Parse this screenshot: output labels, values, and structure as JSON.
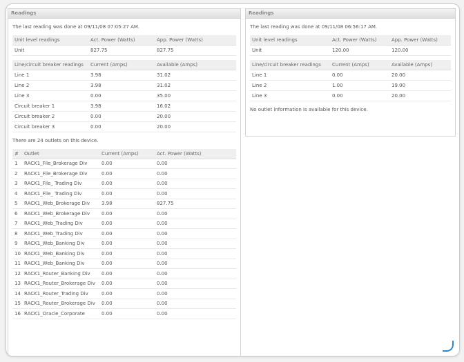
{
  "left": {
    "title": "Readings",
    "last_reading": "The last reading was done at 09/11/08 07:05:27 AM.",
    "unit_headers": [
      "Unit level readings",
      "Act. Power (Watts)",
      "App. Power (Watts)"
    ],
    "unit_rows": [
      [
        "Unit",
        "827.75",
        "827.75"
      ]
    ],
    "breaker_headers": [
      "Line/circuit breaker readings",
      "Current (Amps)",
      "Available (Amps)"
    ],
    "breaker_rows": [
      [
        "Line 1",
        "3.98",
        "31.02"
      ],
      [
        "Line 2",
        "3.98",
        "31.02"
      ],
      [
        "Line 3",
        "0.00",
        "35.00"
      ],
      [
        "Circuit breaker 1",
        "3.98",
        "16.02"
      ],
      [
        "Circuit breaker 2",
        "0.00",
        "20.00"
      ],
      [
        "Circuit breaker 3",
        "0.00",
        "20.00"
      ]
    ],
    "outlet_count_text": "There are 24 outlets on this device.",
    "outlet_headers": [
      "#",
      "Outlet",
      "Current (Amps)",
      "Act. Power (Watts)"
    ],
    "outlet_rows": [
      [
        "1",
        "RACK1_File_Brokerage Div",
        "0.00",
        "0.00"
      ],
      [
        "2",
        "RACK1_File_Brokerage Div",
        "0.00",
        "0.00"
      ],
      [
        "3",
        "RACK1_File_ Trading Div",
        "0.00",
        "0.00"
      ],
      [
        "4",
        "RACK1_File_ Trading Div",
        "0.00",
        "0.00"
      ],
      [
        "5",
        "RACK1_Web_Brokerage Div",
        "3.98",
        "827.75"
      ],
      [
        "6",
        "RACK1_Web_Brokerage Div",
        "0.00",
        "0.00"
      ],
      [
        "7",
        "RACK1_Web_Trading Div",
        "0.00",
        "0.00"
      ],
      [
        "8",
        "RACK1_Web_Trading Div",
        "0.00",
        "0.00"
      ],
      [
        "9",
        "RACK1_Web_Banking Div",
        "0.00",
        "0.00"
      ],
      [
        "10",
        "RACK1_Web_Banking Div",
        "0.00",
        "0.00"
      ],
      [
        "11",
        "RACK1_Web_Banking Div",
        "0.00",
        "0.00"
      ],
      [
        "12",
        "RACK1_Router_Banking Div",
        "0.00",
        "0.00"
      ],
      [
        "13",
        "RACK1_Router_Brokerage Div",
        "0.00",
        "0.00"
      ],
      [
        "14",
        "RACK1_Router_Trading Div",
        "0.00",
        "0.00"
      ],
      [
        "15",
        "RACK1_Router_Brokerage Div",
        "0.00",
        "0.00"
      ],
      [
        "16",
        "RACK1_Oracle_Corporate",
        "0.00",
        "0.00"
      ]
    ]
  },
  "right": {
    "title": "Readings",
    "last_reading": "The last reading was done at 09/11/08 06:56:17 AM.",
    "unit_headers": [
      "Unit level readings",
      "Act. Power (Watts)",
      "App. Power (Watts)"
    ],
    "unit_rows": [
      [
        "Unit",
        "120.00",
        "120.00"
      ]
    ],
    "breaker_headers": [
      "Line/circuit breaker readings",
      "Current (Amps)",
      "Available (Amps)"
    ],
    "breaker_rows": [
      [
        "Line 1",
        "0.00",
        "20.00"
      ],
      [
        "Line 2",
        "1.00",
        "19.00"
      ],
      [
        "Line 3",
        "0.00",
        "20.00"
      ]
    ],
    "no_outlet_text": "No outlet information is available for this device."
  }
}
